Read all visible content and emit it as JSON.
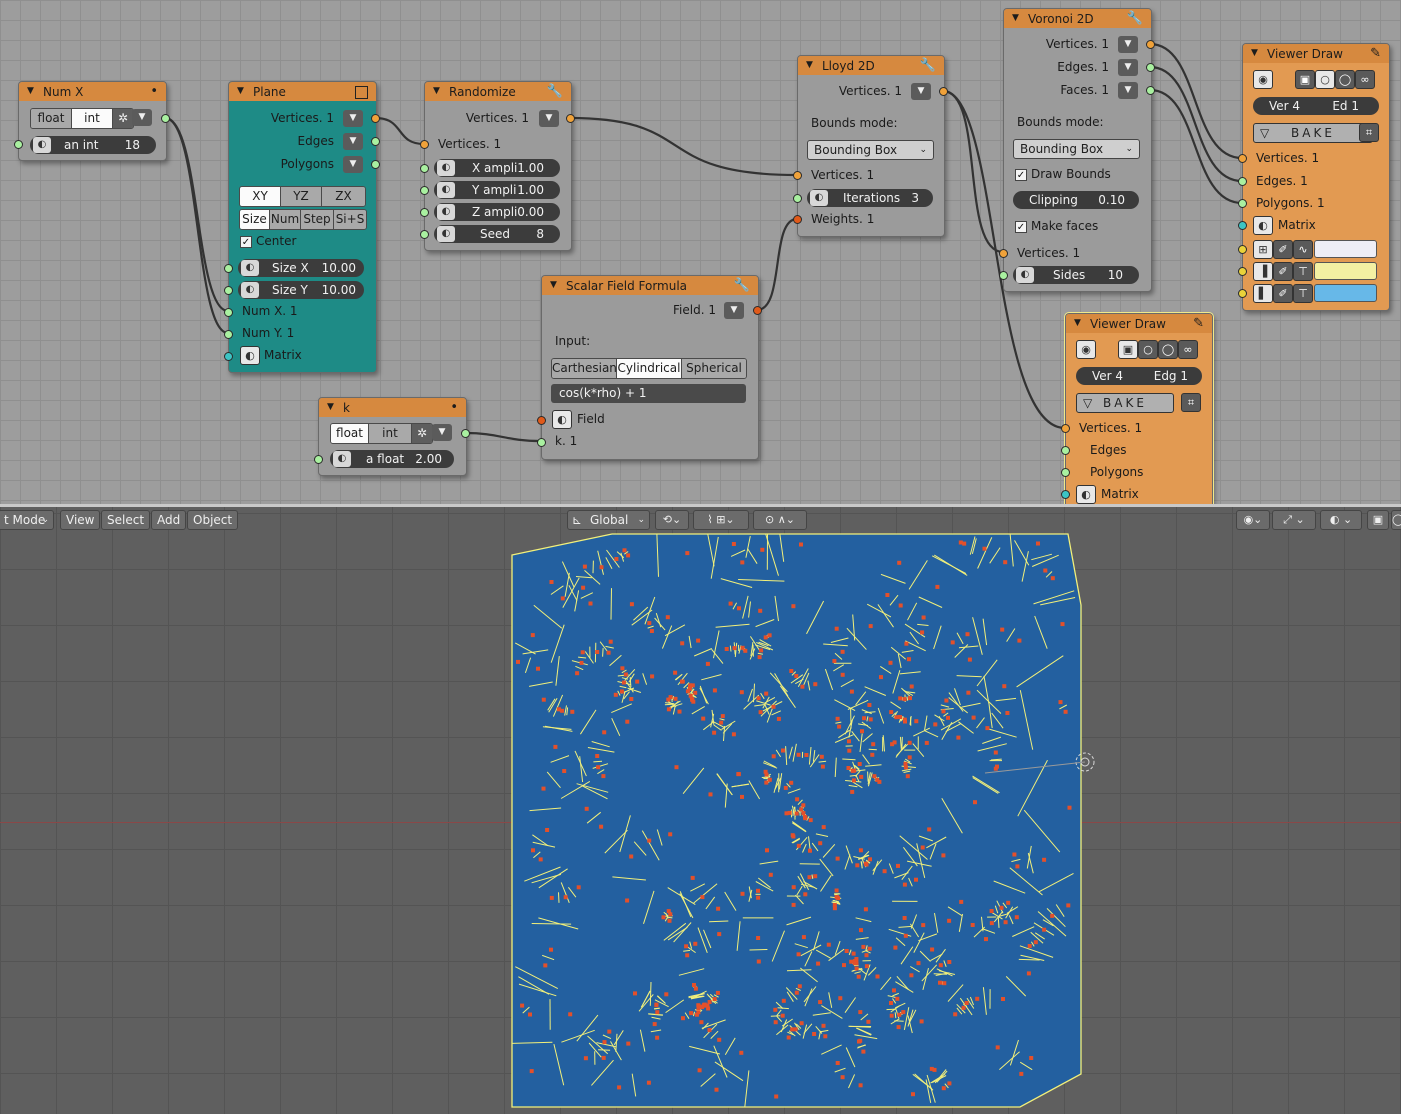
{
  "nodes": {
    "numx": {
      "title": "Num X",
      "mode": [
        "float",
        "int"
      ],
      "field_label": "an int",
      "field_value": "18"
    },
    "plane": {
      "title": "Plane",
      "outputs": [
        "Vertices. 1",
        "Edges",
        "Polygons"
      ],
      "axes": [
        "XY",
        "YZ",
        "ZX"
      ],
      "modes": [
        "Size",
        "Num",
        "Step",
        "Si+S"
      ],
      "center_label": "Center",
      "size_x_label": "Size X",
      "size_x_value": "10.00",
      "size_y_label": "Size Y",
      "size_y_value": "10.00",
      "inputs": [
        "Num X. 1",
        "Num Y. 1",
        "Matrix"
      ]
    },
    "randomize": {
      "title": "Randomize",
      "output": "Vertices. 1",
      "input": "Vertices. 1",
      "params": [
        {
          "label": "X ampli",
          "value": "1.00"
        },
        {
          "label": "Y ampli",
          "value": "1.00"
        },
        {
          "label": "Z ampli",
          "value": "0.00"
        },
        {
          "label": "Seed",
          "value": "8"
        }
      ]
    },
    "k": {
      "title": "k",
      "mode": [
        "float",
        "int"
      ],
      "field_label": "a float",
      "field_value": "2.00"
    },
    "sff": {
      "title": "Scalar Field Formula",
      "output": "Field. 1",
      "input_label": "Input:",
      "coords": [
        "Carthesian",
        "Cylindrical",
        "Spherical"
      ],
      "formula": "cos(k*rho) + 1",
      "inputs": [
        "Field",
        "k. 1"
      ]
    },
    "lloyd": {
      "title": "Lloyd 2D",
      "output": "Vertices. 1",
      "bounds_label": "Bounds mode:",
      "bounds_value": "Bounding Box",
      "input_vertices": "Vertices. 1",
      "iterations_label": "Iterations",
      "iterations_value": "3",
      "weights": "Weights. 1"
    },
    "voronoi": {
      "title": "Voronoi 2D",
      "outputs": [
        "Vertices. 1",
        "Edges. 1",
        "Faces. 1"
      ],
      "bounds_label": "Bounds mode:",
      "bounds_value": "Bounding Box",
      "draw_bounds": "Draw Bounds",
      "clipping_label": "Clipping",
      "clipping_value": "0.10",
      "make_faces": "Make faces",
      "input_vertices": "Vertices. 1",
      "sides_label": "Sides",
      "sides_value": "10"
    },
    "viewer1": {
      "title": "Viewer Draw",
      "ver_label": "Ver 4",
      "ed_label": "Ed  1",
      "bake": "BAKE",
      "inputs": [
        "Vertices. 1",
        "Edges. 1",
        "Polygons. 1",
        "Matrix"
      ],
      "colors": [
        "#eeeef6",
        "#f3f0a2",
        "#67b8e8"
      ]
    },
    "viewer2": {
      "title": "Viewer Draw",
      "ver_label": "Ver  4",
      "edg_label": "Edg  1",
      "bake": "BAKE",
      "inputs": [
        "Vertices. 1",
        "Edges",
        "Polygons",
        "Matrix"
      ]
    }
  },
  "viewport": {
    "mode_label": "t Mode",
    "menu": [
      "View",
      "Select",
      "Add",
      "Object"
    ],
    "orientation": "Global",
    "mesh_colors": {
      "face": "#2360a0",
      "edge": "#f2f07a",
      "point": "#e4502a"
    }
  }
}
